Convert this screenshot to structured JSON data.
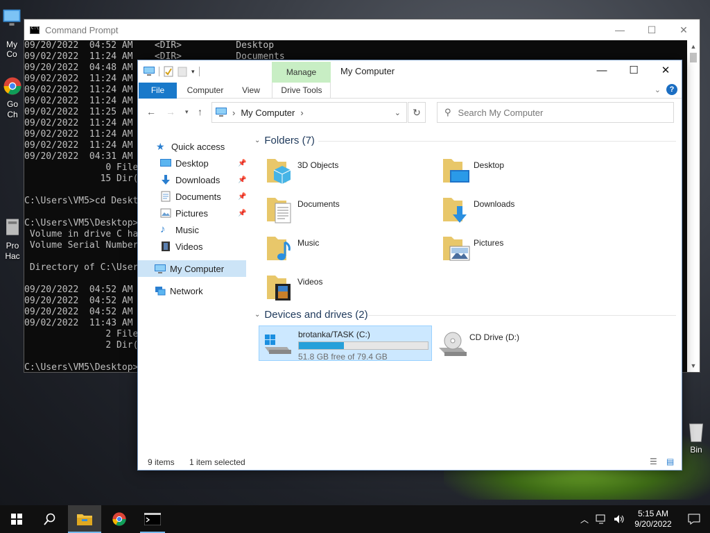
{
  "desktop": {
    "icons": [
      {
        "label": "My Co"
      },
      {
        "label": "Go\nCh"
      },
      {
        "label": "Pro\nHac"
      }
    ],
    "recycle_label": "Bin"
  },
  "cmd": {
    "title": "Command Prompt",
    "lines": [
      "09/20/2022  04:52 AM    <DIR>          Desktop",
      "09/02/2022  11:24 AM    <DIR>          Documents",
      "09/20/2022  04:48 AM",
      "09/02/2022  11:24 AM",
      "09/02/2022  11:24 AM",
      "09/02/2022  11:24 AM",
      "09/02/2022  11:25 AM",
      "09/02/2022  11:24 AM",
      "09/02/2022  11:24 AM",
      "09/02/2022  11:24 AM",
      "09/20/2022  04:31 AM",
      "               0 File",
      "              15 Dir(",
      "",
      "C:\\Users\\VM5>cd Deskt",
      "",
      "C:\\Users\\VM5\\Desktop>",
      " Volume in drive C ha",
      " Volume Serial Number",
      "",
      " Directory of C:\\User",
      "",
      "09/20/2022  04:52 AM",
      "09/20/2022  04:52 AM",
      "09/20/2022  04:52 AM",
      "09/02/2022  11:43 AM",
      "               2 File",
      "               2 Dir(",
      "",
      "C:\\Users\\VM5\\Desktop>"
    ]
  },
  "explorer": {
    "title": "My Computer",
    "manage_tab": "Manage",
    "ribbon_tabs": {
      "file": "File",
      "computer": "Computer",
      "view": "View",
      "drive_tools": "Drive Tools"
    },
    "address": {
      "location": "My Computer",
      "chevron": "›"
    },
    "search": {
      "placeholder": "Search My Computer"
    },
    "nav": {
      "quick_access": "Quick access",
      "items": [
        "Desktop",
        "Downloads",
        "Documents",
        "Pictures",
        "Music",
        "Videos"
      ],
      "my_computer": "My Computer",
      "network": "Network"
    },
    "folders_group": "Folders (7)",
    "folders": [
      {
        "name": "3D Objects",
        "icon": "3d-objects-icon"
      },
      {
        "name": "Desktop",
        "icon": "desktop-folder-icon"
      },
      {
        "name": "Documents",
        "icon": "documents-folder-icon"
      },
      {
        "name": "Downloads",
        "icon": "downloads-folder-icon"
      },
      {
        "name": "Music",
        "icon": "music-folder-icon"
      },
      {
        "name": "Pictures",
        "icon": "pictures-folder-icon"
      },
      {
        "name": "Videos",
        "icon": "videos-folder-icon"
      }
    ],
    "devices_group": "Devices and drives (2)",
    "drives": [
      {
        "name": "brotanka/TASK (C:)",
        "free": "51.8 GB free of 79.4 GB",
        "used_fraction": 0.348
      },
      {
        "name": "CD Drive (D:)"
      }
    ],
    "status": {
      "items": "9 items",
      "selected": "1 item selected"
    }
  },
  "taskbar": {
    "time": "5:15 AM",
    "date": "9/20/2022"
  },
  "colors": {
    "accent": "#1979ca",
    "selection": "#cce8ff",
    "manage_tab": "#c8eec4",
    "drive_fill": "#26a0da"
  }
}
